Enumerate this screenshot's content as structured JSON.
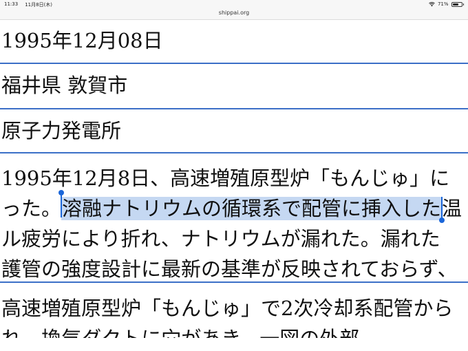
{
  "statusbar": {
    "time": "11:33",
    "date": "11月8日(木)",
    "url": "shippai.org",
    "battery": "71%",
    "battery_level": 0.71
  },
  "rows": {
    "date": "1995年12月08日",
    "location": "福井県 敦賀市",
    "facility": "原子力発電所",
    "description": {
      "line1": "1995年12月8日、高速増殖原型炉「もんじゅ」に",
      "line2_before": "った。",
      "line2_selected": "溶融ナトリウムの循環系で配管に挿入した",
      "line2_after": "温",
      "line3": "ル疲労により折れ、ナトリウムが漏れた。漏れた",
      "line4": "護管の強度設計に最新の基準が反映されておらず、"
    },
    "next": {
      "line1": "高速増殖原型炉「もんじゅ」で2次冷却系配管から",
      "line2": "れ、換気ダクトに穴があき、一図の外部"
    }
  }
}
